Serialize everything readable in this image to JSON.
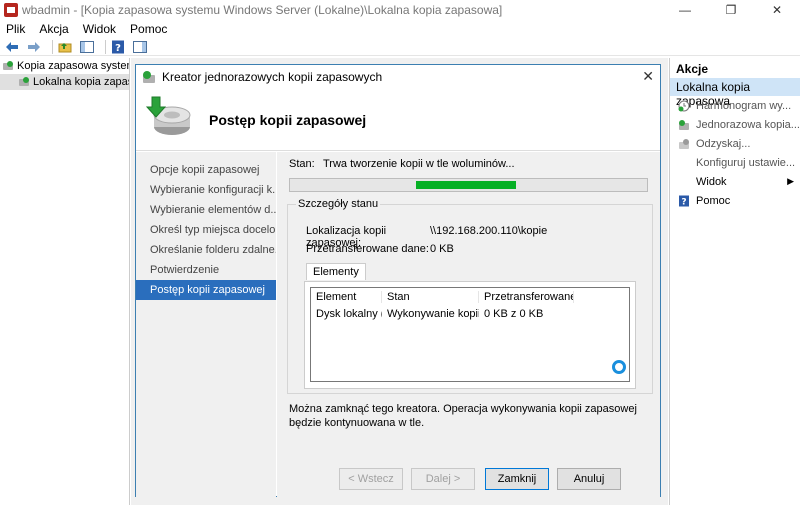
{
  "window": {
    "title": "wbadmin - [Kopia zapasowa systemu Windows Server (Lokalne)\\Lokalna kopia zapasowa]",
    "minimize": "—",
    "maximize": "❐",
    "close": "✕"
  },
  "menu": [
    "Plik",
    "Akcja",
    "Widok",
    "Pomoc"
  ],
  "tree": {
    "root": "Kopia zapasowa systemu W",
    "child": "Lokalna kopia zapaso"
  },
  "actions": {
    "header": "Akcje",
    "subheader": "Lokalna kopia zapasowa",
    "items": [
      {
        "label": "Harmonogram wy...",
        "icon": "schedule-icon"
      },
      {
        "label": "Jednorazowa kopia...",
        "icon": "backup-once-icon"
      },
      {
        "label": "Odzyskaj...",
        "icon": "recover-icon"
      },
      {
        "label": "Konfiguruj ustawie...",
        "icon": ""
      },
      {
        "label": "Widok",
        "icon": ""
      },
      {
        "label": "Pomoc",
        "icon": "help-icon"
      }
    ]
  },
  "dialog": {
    "title": "Kreator jednorazowych kopii zapasowych",
    "close": "✕",
    "header_title": "Postęp kopii zapasowej",
    "steps": [
      "Opcje kopii zapasowej",
      "Wybieranie konfiguracji k...",
      "Wybieranie elementów d...",
      "Określ typ miejsca docelo...",
      "Określanie folderu zdalne...",
      "Potwierdzenie",
      "Postęp kopii zapasowej"
    ],
    "status_label": "Stan:",
    "status_value": "Trwa tworzenie kopii w tle woluminów...",
    "group_title": "Szczegóły stanu",
    "location_label": "Lokalizacja kopii zapasowej:",
    "location_value": "\\\\192.168.200.110\\kopie",
    "transferred_label": "Przetransferowane dane:",
    "transferred_value": "0 KB",
    "tab_label": "Elementy",
    "columns": [
      "Element",
      "Stan",
      "Przetransferowane ..."
    ],
    "rows": [
      [
        "Dysk lokalny (...",
        "Wykonywanie kopii...",
        "0 KB z 0 KB"
      ]
    ],
    "note": "Można zamknąć tego kreatora. Operacja wykonywania kopii zapasowej będzie kontynuowana w tle.",
    "buttons": {
      "back": "< Wstecz",
      "next": "Dalej >",
      "close": "Zamknij",
      "cancel": "Anuluj"
    }
  }
}
